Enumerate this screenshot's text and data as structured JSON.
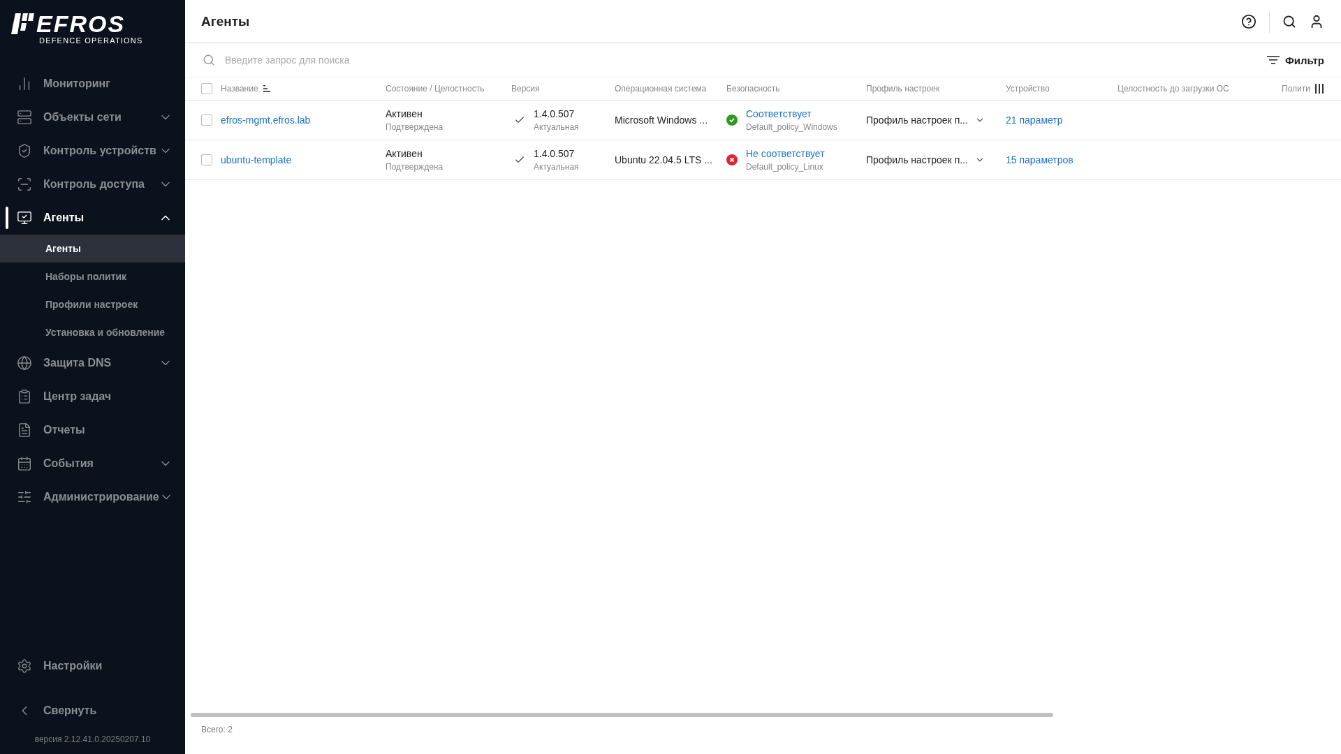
{
  "logo": {
    "name": "EFROS",
    "tagline": "DEFENCE OPERATIONS"
  },
  "sidebar": {
    "items": [
      {
        "label": "Мониторинг",
        "selected": false
      },
      {
        "label": "Объекты сети",
        "expanded": false,
        "selected": false
      },
      {
        "label": "Контроль устройств",
        "expanded": false,
        "selected": false
      },
      {
        "label": "Контроль доступа",
        "expanded": false,
        "selected": false
      },
      {
        "label": "Агенты",
        "expanded": true,
        "selected": true,
        "children": [
          {
            "label": "Агенты",
            "selected": true
          },
          {
            "label": "Наборы политик",
            "selected": false
          },
          {
            "label": "Профили настроек",
            "selected": false
          },
          {
            "label": "Установка и обновление",
            "selected": false
          }
        ]
      },
      {
        "label": "Защита DNS",
        "expanded": false,
        "selected": false
      },
      {
        "label": "Центр задач",
        "selected": false
      },
      {
        "label": "Отчеты",
        "selected": false
      },
      {
        "label": "События",
        "expanded": false,
        "selected": false
      },
      {
        "label": "Администрирование",
        "expanded": false,
        "selected": false
      }
    ],
    "settings": "Настройки",
    "collapse": "Свернуть",
    "version": "версия 2.12.41.0.20250207.10"
  },
  "header": {
    "title": "Агенты"
  },
  "search": {
    "placeholder": "Введите запрос для поиска"
  },
  "filter_button": "Фильтр",
  "table": {
    "columns": [
      {
        "label": "Название",
        "sorted": true
      },
      {
        "label": "Состояние / Целостность",
        "sorted": false
      },
      {
        "label": "Версия",
        "sorted": false
      },
      {
        "label": "Операционная система",
        "sorted": false
      },
      {
        "label": "Безопасность",
        "sorted": false
      },
      {
        "label": "Профиль настроек",
        "sorted": false
      },
      {
        "label": "Устройство",
        "sorted": false
      },
      {
        "label": "Целостность до загрузки ОС",
        "sorted": false
      },
      {
        "label": "Полити",
        "sorted": false
      }
    ],
    "all_checked": false,
    "rows": [
      {
        "checked": false,
        "name": "efros-mgmt.efros.lab",
        "state": "Активен",
        "integrity": "Подтверждена",
        "version": "1.4.0.507",
        "version_status": "Актуальная",
        "os": "Microsoft Windows ...",
        "compliant": true,
        "security": "Соответствует",
        "policy": "Default_policy_Windows",
        "profile": "Профиль настроек п...",
        "device": "21 параметр"
      },
      {
        "checked": false,
        "name": "ubuntu-template",
        "state": "Активен",
        "integrity": "Подтверждена",
        "version": "1.4.0.507",
        "version_status": "Актуальная",
        "os": "Ubuntu 22.04.5 LTS ...",
        "compliant": false,
        "security": "Не соответствует",
        "policy": "Default_policy_Linux",
        "profile": "Профиль настроек п...",
        "device": "15 параметров"
      }
    ]
  },
  "footer": {
    "total": "Всего: 2"
  }
}
